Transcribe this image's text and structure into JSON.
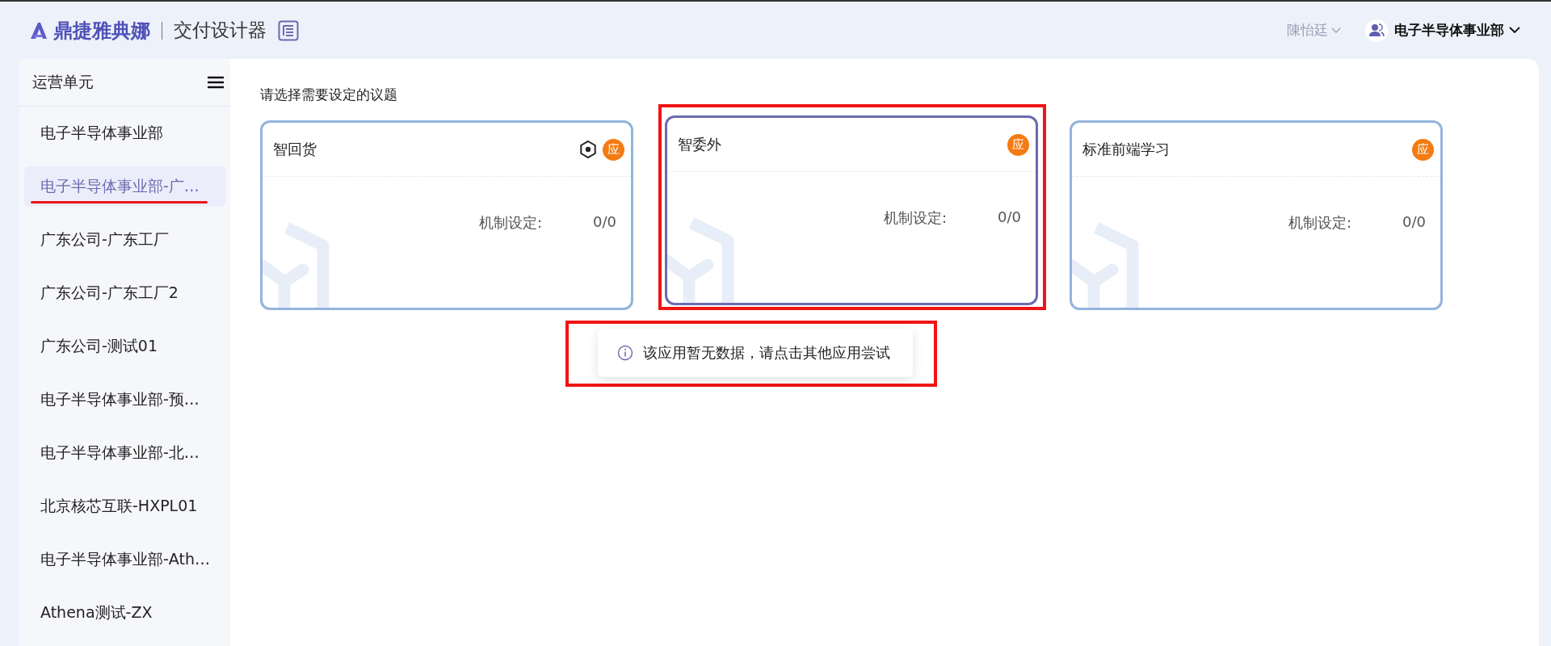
{
  "header": {
    "logo": "鼎捷雅典娜",
    "app_title": "交付设计器",
    "user": "陳怡廷",
    "org": "电子半导体事业部"
  },
  "sidebar": {
    "title": "运营单元",
    "items": [
      {
        "label": "电子半导体事业部",
        "selected": false,
        "underlined": false
      },
      {
        "label": "电子半导体事业部-广…",
        "selected": true,
        "underlined": true
      },
      {
        "label": "广东公司-广东工厂",
        "selected": false,
        "underlined": false
      },
      {
        "label": "广东公司-广东工厂2",
        "selected": false,
        "underlined": false
      },
      {
        "label": "广东公司-测试01",
        "selected": false,
        "underlined": false
      },
      {
        "label": "电子半导体事业部-预…",
        "selected": false,
        "underlined": false
      },
      {
        "label": "电子半导体事业部-北…",
        "selected": false,
        "underlined": false
      },
      {
        "label": "北京核芯互联-HXPL01",
        "selected": false,
        "underlined": false
      },
      {
        "label": "电子半导体事业部-Ath…",
        "selected": false,
        "underlined": false
      },
      {
        "label": "Athena测试-ZX",
        "selected": false,
        "underlined": false
      }
    ]
  },
  "main": {
    "prompt": "请选择需要设定的议题",
    "cards": [
      {
        "title": "智回货",
        "settings_icon": true,
        "badge": "应",
        "metric_label": "机制设定:",
        "metric_value": "0/0",
        "selected": false,
        "highlighted": false
      },
      {
        "title": "智委外",
        "settings_icon": false,
        "badge": "应",
        "metric_label": "机制设定:",
        "metric_value": "0/0",
        "selected": true,
        "highlighted": true
      },
      {
        "title": "标准前端学习",
        "settings_icon": false,
        "badge": "应",
        "metric_label": "机制设定:",
        "metric_value": "0/0",
        "selected": false,
        "highlighted": false
      }
    ]
  },
  "toast": {
    "message": "该应用暂无数据，请点击其他应用尝试",
    "highlighted": true
  }
}
